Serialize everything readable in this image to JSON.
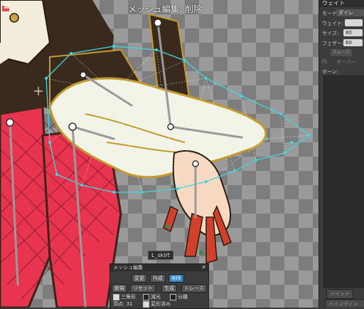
{
  "canvas": {
    "mode_title": "メッシュ編集: 削除",
    "layer_label": "L_skirt"
  },
  "panel": {
    "title": "ウェイト",
    "mode_label": "モード:",
    "mode_value": "ダイレ",
    "weight_label": "ウェイト:",
    "size_label": "サイズ:",
    "size_value": "80",
    "feather_label": "フェザー:",
    "feather_value": "60",
    "smooth_label": "スムーズ",
    "circle_label": "円",
    "over_label": "オーバー",
    "bones_label": "ボーン:",
    "bind_label": "バインド",
    "unbind_label": "バインディング"
  },
  "tool": {
    "title": "メッシュ編集",
    "btn_change": "変更",
    "btn_create": "作成",
    "btn_delete": "削除",
    "btn_new": "新規",
    "btn_reset": "リセット",
    "btn_generate": "生成",
    "btn_trace": "トレース",
    "chk_triangle": "三角形",
    "chk_subtract": "減光",
    "chk_separate": "分離",
    "vertex_label": "頂点: 31",
    "chk_deformed": "変形済み"
  },
  "colors": {
    "mesh": "#3fd6e0",
    "stocking": "#e8344f",
    "skin": "#f6d9c0",
    "sleeve": "#f1f4e6",
    "accent": "#2d7bb6"
  }
}
